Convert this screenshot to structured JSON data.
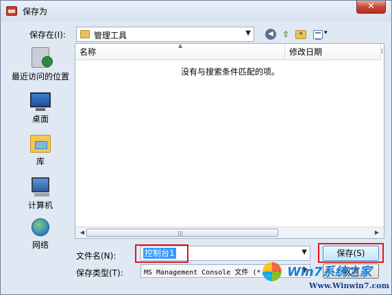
{
  "window": {
    "title": "保存为",
    "close_glyph": "✕"
  },
  "location": {
    "label": "保存在(I):",
    "value": "管理工具",
    "arrow": "▼"
  },
  "toolbar": {
    "back_glyph": "◀",
    "up_glyph": "⇧",
    "newfolder_glyph": "✦",
    "view_arrow": "▾",
    "icons": [
      "back-icon",
      "up-folder-icon",
      "new-folder-icon",
      "view-menu-icon"
    ]
  },
  "places": [
    {
      "label": "最近访问的位置",
      "icon": "recent-places-icon"
    },
    {
      "label": "桌面",
      "icon": "desktop-icon"
    },
    {
      "label": "库",
      "icon": "libraries-icon"
    },
    {
      "label": "计算机",
      "icon": "computer-icon"
    },
    {
      "label": "网络",
      "icon": "network-icon"
    }
  ],
  "filelist": {
    "columns": [
      "名称",
      "修改日期"
    ],
    "sort_glyph": "▲",
    "more_glyph": "⁝",
    "empty_message": "没有与搜索条件匹配的项。",
    "scroll_left": "◀",
    "scroll_right": "▶",
    "scroll_grip": "|||"
  },
  "form": {
    "filename_label": "文件名(N):",
    "filename_value": "控制台1",
    "filename_arrow": "▼",
    "filetype_label": "保存类型(T):",
    "filetype_value": "MS Management Console 文件 (*.msc)",
    "filetype_arrow": "▼"
  },
  "buttons": {
    "save_label": "保存(S)",
    "cancel_label": "取消"
  },
  "watermark": {
    "title": "Win7系统之家",
    "url": "Www.Winwin7.com"
  },
  "colors": {
    "highlight": "#e0141a",
    "selection": "#3399ff",
    "window_bg": "#dfe8f3"
  }
}
